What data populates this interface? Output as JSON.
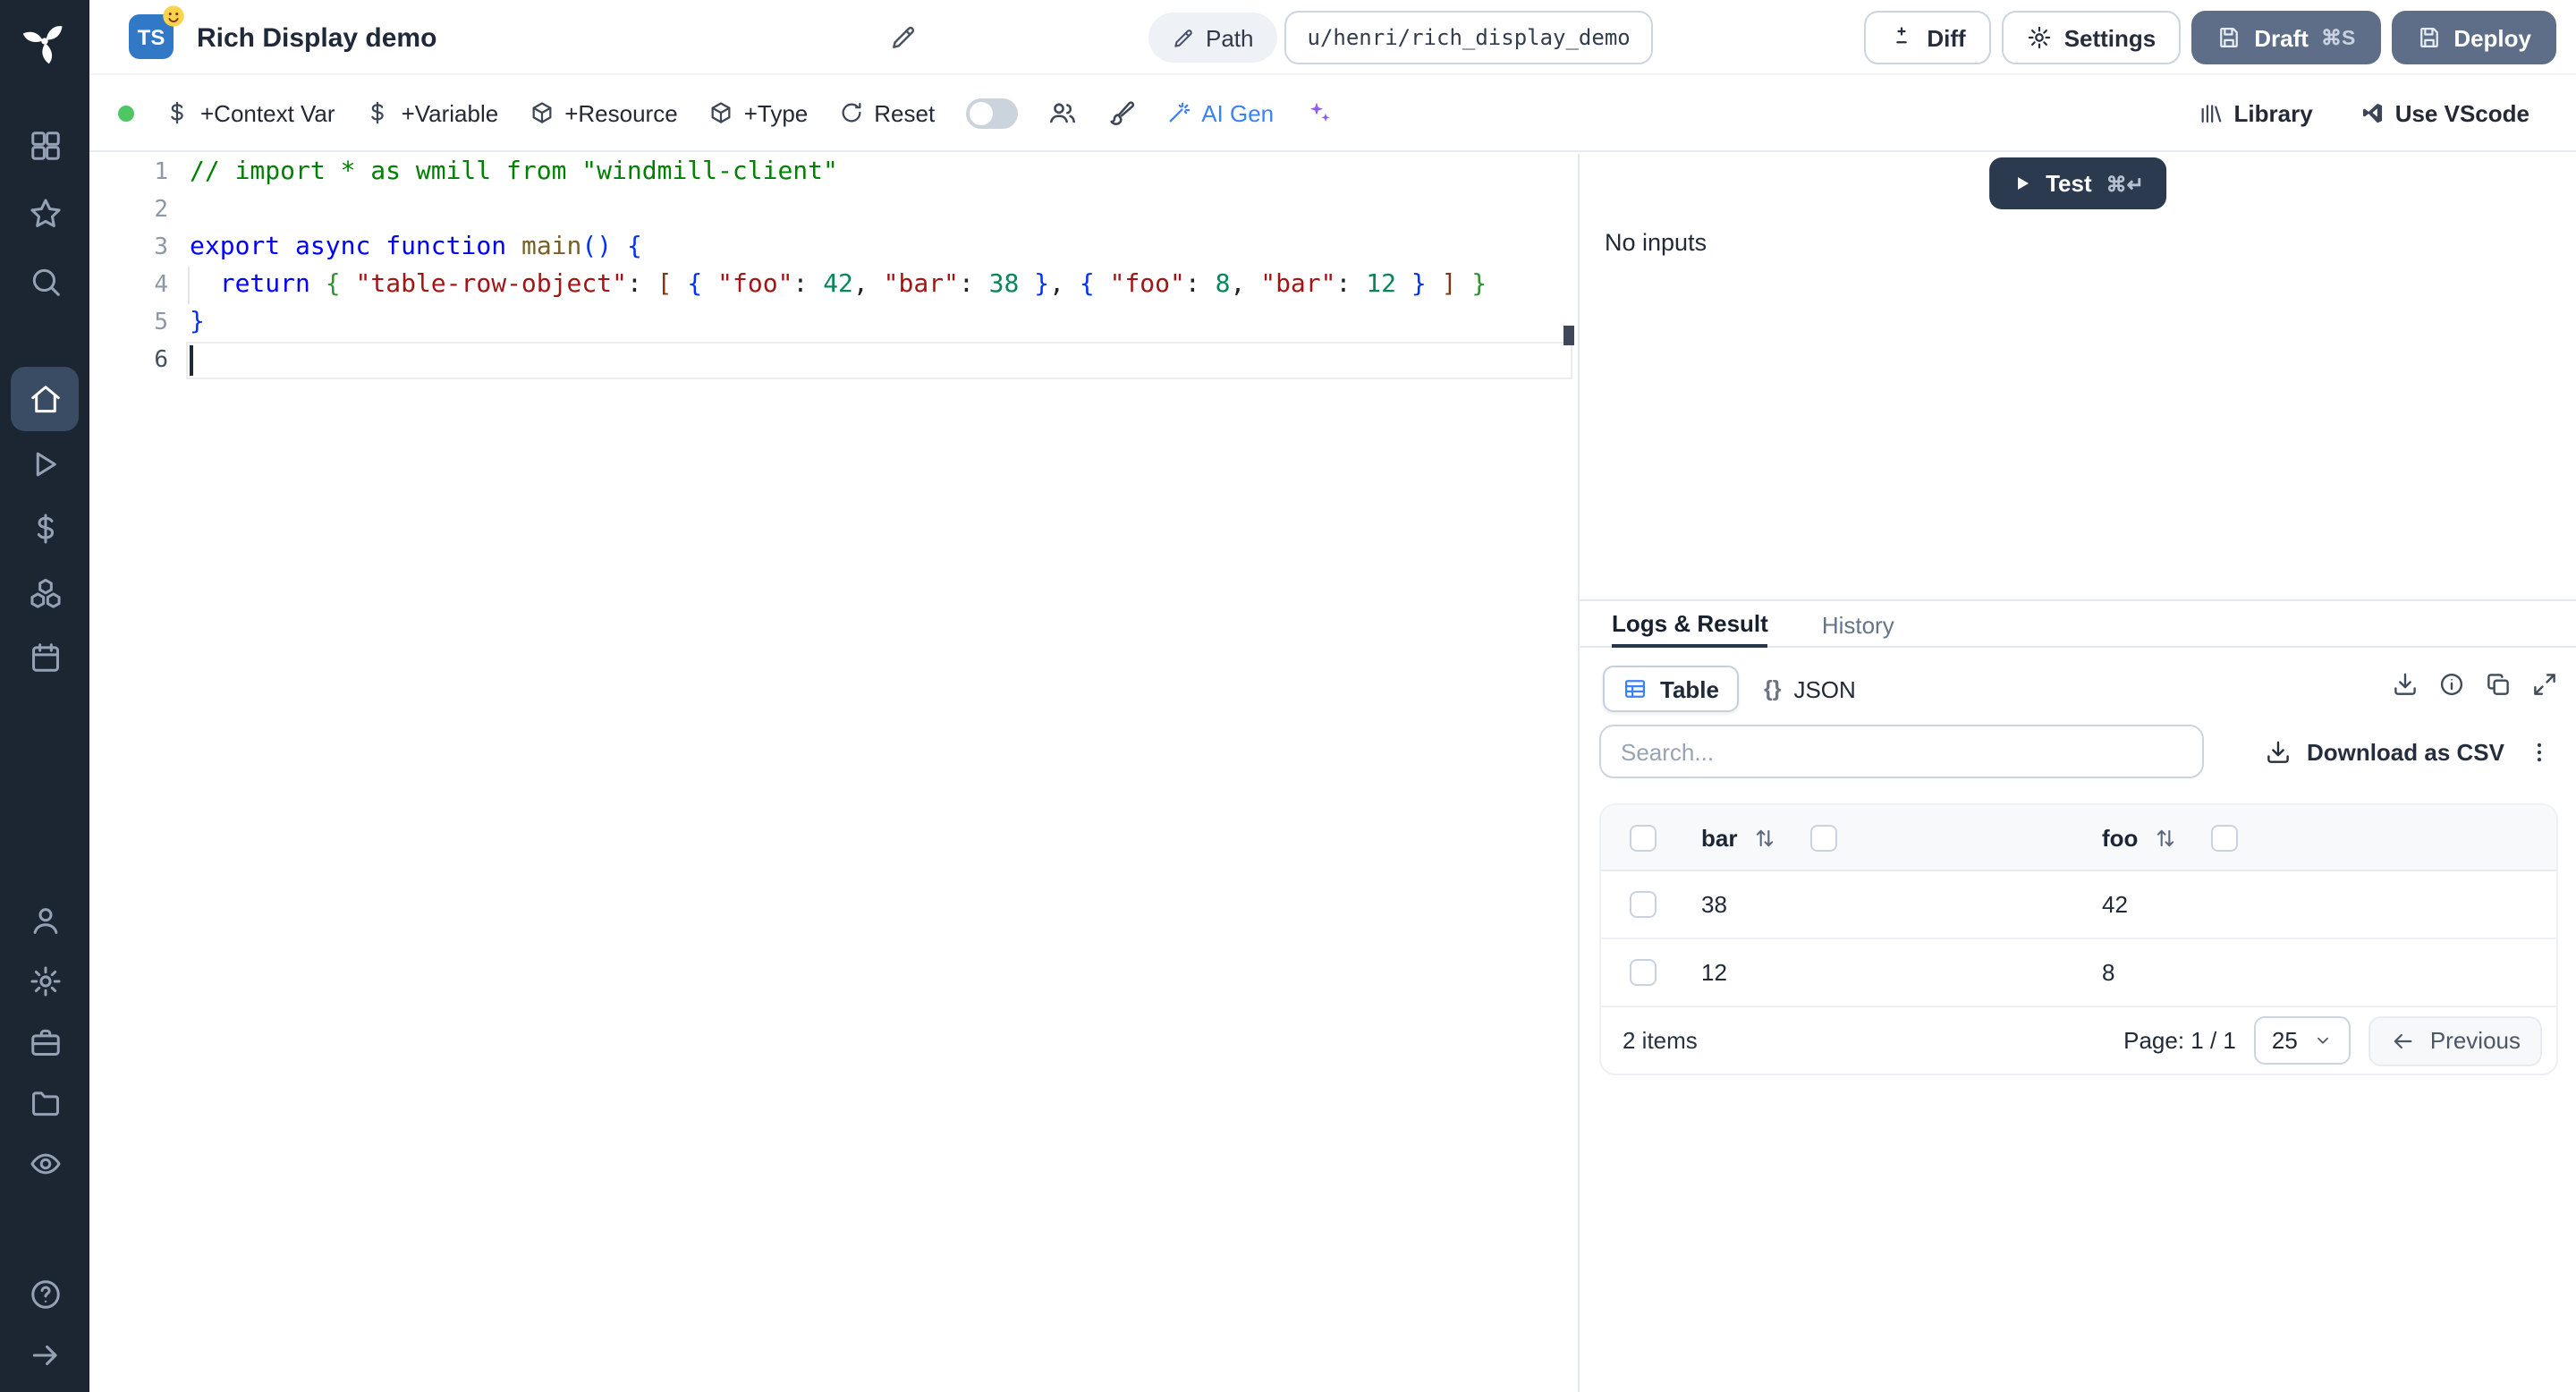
{
  "header": {
    "lang_badge": "TS",
    "title": "Rich Display demo",
    "path_label": "Path",
    "path_value": "u/henri/rich_display_demo",
    "diff_label": "Diff",
    "settings_label": "Settings",
    "draft_label": "Draft",
    "draft_shortcut": "⌘S",
    "deploy_label": "Deploy"
  },
  "toolbar": {
    "context_var": "+Context Var",
    "variable": "+Variable",
    "resource": "+Resource",
    "type": "+Type",
    "reset": "Reset",
    "ai_gen": "AI Gen",
    "library": "Library",
    "use_vscode": "Use VScode"
  },
  "sidebar": {
    "top_icons": [
      "apps-icon",
      "star-icon",
      "search-icon"
    ],
    "main_icons": [
      "home-icon",
      "play-icon",
      "dollar-icon",
      "resources-icon",
      "calendar-icon"
    ],
    "lower_icons": [
      "user-icon",
      "gear-icon",
      "briefcase-icon",
      "folder-icon",
      "eye-icon"
    ],
    "bottom_icons": [
      "help-icon",
      "arrow-right-icon"
    ],
    "active": "home-icon"
  },
  "editor": {
    "lines": [
      {
        "n": "1",
        "tokens": [
          {
            "t": "// import * as wmill from \"windmill-client\"",
            "c": "cm"
          }
        ]
      },
      {
        "n": "2",
        "tokens": []
      },
      {
        "n": "3",
        "tokens": [
          {
            "t": "export",
            "c": "kw"
          },
          {
            "t": " ",
            "c": "pl"
          },
          {
            "t": "async",
            "c": "kw"
          },
          {
            "t": " ",
            "c": "pl"
          },
          {
            "t": "function",
            "c": "kw"
          },
          {
            "t": " ",
            "c": "pl"
          },
          {
            "t": "main",
            "c": "fn"
          },
          {
            "t": "(",
            "c": "b1"
          },
          {
            "t": ")",
            "c": "b1"
          },
          {
            "t": " ",
            "c": "pl"
          },
          {
            "t": "{",
            "c": "b1"
          }
        ]
      },
      {
        "n": "4",
        "tokens": [
          {
            "t": "  ",
            "c": "pl"
          },
          {
            "t": "return",
            "c": "kw"
          },
          {
            "t": " ",
            "c": "pl"
          },
          {
            "t": "{",
            "c": "b2"
          },
          {
            "t": " ",
            "c": "pl"
          },
          {
            "t": "\"table-row-object\"",
            "c": "str"
          },
          {
            "t": ": ",
            "c": "pl"
          },
          {
            "t": "[",
            "c": "b3"
          },
          {
            "t": " ",
            "c": "pl"
          },
          {
            "t": "{",
            "c": "b1"
          },
          {
            "t": " ",
            "c": "pl"
          },
          {
            "t": "\"foo\"",
            "c": "str"
          },
          {
            "t": ": ",
            "c": "pl"
          },
          {
            "t": "42",
            "c": "num"
          },
          {
            "t": ", ",
            "c": "pl"
          },
          {
            "t": "\"bar\"",
            "c": "str"
          },
          {
            "t": ": ",
            "c": "pl"
          },
          {
            "t": "38",
            "c": "num"
          },
          {
            "t": " ",
            "c": "pl"
          },
          {
            "t": "}",
            "c": "b1"
          },
          {
            "t": ", ",
            "c": "pl"
          },
          {
            "t": "{",
            "c": "b1"
          },
          {
            "t": " ",
            "c": "pl"
          },
          {
            "t": "\"foo\"",
            "c": "str"
          },
          {
            "t": ": ",
            "c": "pl"
          },
          {
            "t": "8",
            "c": "num"
          },
          {
            "t": ", ",
            "c": "pl"
          },
          {
            "t": "\"bar\"",
            "c": "str"
          },
          {
            "t": ": ",
            "c": "pl"
          },
          {
            "t": "12",
            "c": "num"
          },
          {
            "t": " ",
            "c": "pl"
          },
          {
            "t": "}",
            "c": "b1"
          },
          {
            "t": " ",
            "c": "pl"
          },
          {
            "t": "]",
            "c": "b3"
          },
          {
            "t": " ",
            "c": "pl"
          },
          {
            "t": "}",
            "c": "b2"
          }
        ]
      },
      {
        "n": "5",
        "tokens": [
          {
            "t": "}",
            "c": "b1"
          }
        ]
      },
      {
        "n": "6",
        "tokens": [],
        "current": true
      }
    ]
  },
  "run_panel": {
    "test_label": "Test",
    "test_shortcut": "⌘↵",
    "no_inputs": "No inputs"
  },
  "result": {
    "tab_logs": "Logs & Result",
    "tab_history": "History",
    "view_table": "Table",
    "view_json": "JSON",
    "json_prefix": "{}",
    "search_placeholder": "Search...",
    "download_csv": "Download as CSV",
    "table": {
      "columns": [
        "bar",
        "foo"
      ],
      "rows": [
        [
          "38",
          "42"
        ],
        [
          "12",
          "8"
        ]
      ]
    },
    "items_count": "2 items",
    "page_label": "Page: 1 / 1",
    "page_size": "25",
    "previous": "Previous"
  },
  "colors": {
    "sidebar_bg": "#1c2633",
    "primary_button": "#5e6e88",
    "test_button": "#2c3a50",
    "ts_badge": "#3178c6",
    "status_ok": "#4cc764",
    "ai_accent": "#3b82f6"
  }
}
